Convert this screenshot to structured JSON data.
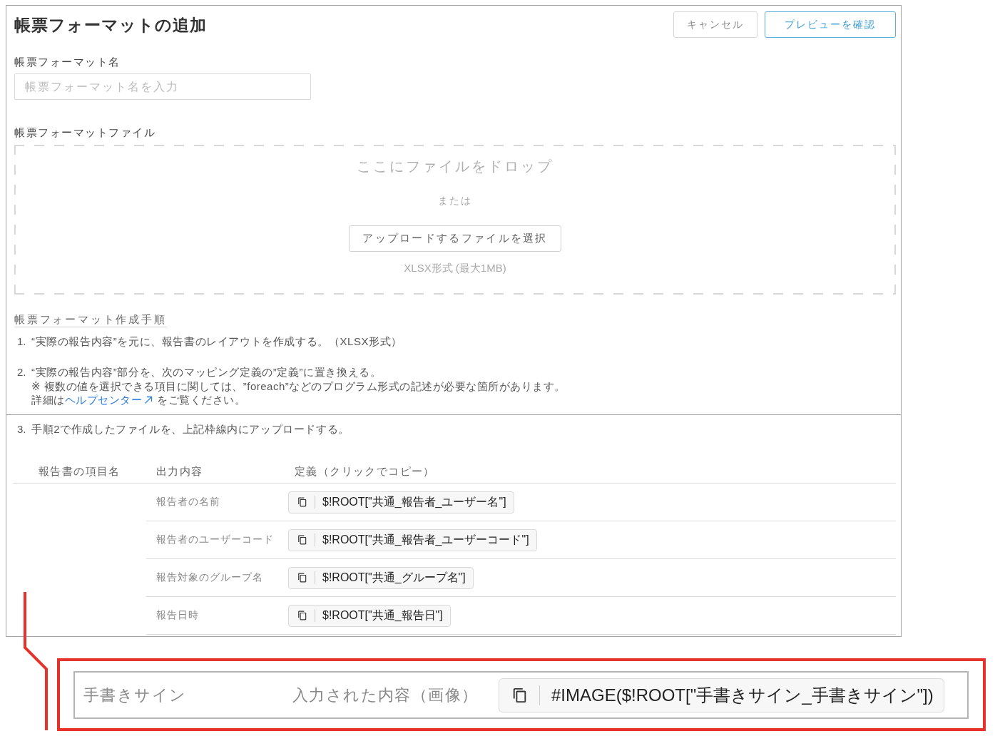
{
  "header": {
    "title": "帳票フォーマットの追加",
    "buttons": [
      {
        "label": "キャンセル",
        "kind": "secondary"
      },
      {
        "label": "プレビューを確認",
        "kind": "primary"
      }
    ]
  },
  "name_field": {
    "label": "帳票フォーマット名",
    "placeholder": "帳票フォーマット名を入力"
  },
  "file_field": {
    "label": "帳票フォーマットファイル",
    "drop_text": "ここにファイルをドロップ",
    "separator_text": "または",
    "button": "アップロードするファイルを選択",
    "hint": "XLSX形式 (最大1MB)"
  },
  "instructions": {
    "title": "帳票フォーマット作成手順",
    "steps": [
      {
        "number": "1.",
        "text": "“実際の報告内容”を元に、報告書のレイアウトを作成する。（XLSX形式）"
      },
      {
        "number": "2.",
        "text": "“実際の報告内容”部分を、次のマッピング定義の”定義”に置き換える。",
        "note": "※ 複数の値を選択できる項目に関しては、”foreach”などのプログラム形式の記述が必要な箇所があります。",
        "detail": {
          "before": "詳細は",
          "link": "ヘルプセンター",
          "after": "をご覧ください。"
        }
      }
    ]
  },
  "mapping": {
    "step": {
      "number": "3.",
      "text": "手順2で作成したファイルを、上記枠線内にアップロードする。"
    },
    "columns": [
      "報告書の項目名",
      "出力内容",
      "定義（クリックでコピー）"
    ],
    "rows": [
      {
        "output": "報告者の名前",
        "definition": "$!ROOT[\"共通_報告者_ユーザー名\"]"
      },
      {
        "output": "報告者のユーザーコード",
        "definition": "$!ROOT[\"共通_報告者_ユーザーコード\"]"
      },
      {
        "output": "報告対象のグループ名",
        "definition": "$!ROOT[\"共通_グループ名\"]"
      },
      {
        "output": "報告日時",
        "definition": "$!ROOT[\"共通_報告日\"]"
      }
    ]
  },
  "callout": {
    "item": "手書きサイン",
    "output": "入力された内容（画像）",
    "definition": "#IMAGE($!ROOT[\"手書きサイン_手書きサイン\"])"
  }
}
